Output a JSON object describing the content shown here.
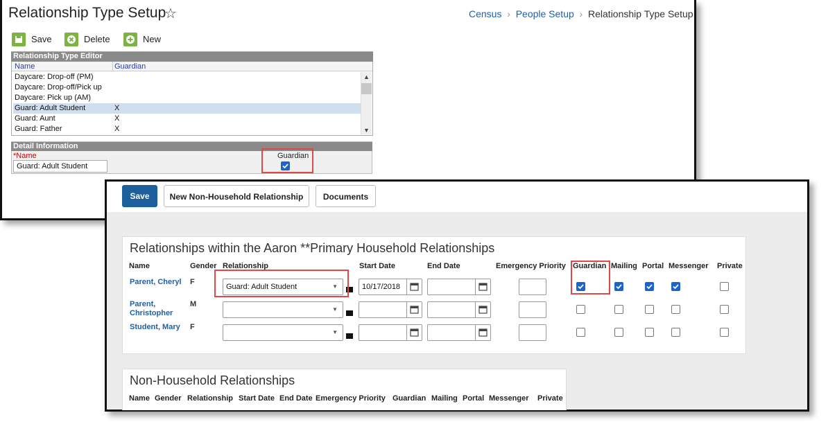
{
  "setup": {
    "title": "Relationship Type Setup",
    "star_icon": "star-icon",
    "breadcrumb": [
      "Census",
      "People Setup",
      "Relationship Type Setup"
    ],
    "toolbar": {
      "save": "Save",
      "delete": "Delete",
      "new": "New"
    },
    "editor": {
      "header": "Relationship Type Editor",
      "col_name": "Name",
      "col_guardian": "Guardian",
      "rows": [
        {
          "name": "Daycare: Drop-off (PM)",
          "guardian": ""
        },
        {
          "name": "Daycare: Drop-off/Pick up",
          "guardian": ""
        },
        {
          "name": "Daycare: Pick up (AM)",
          "guardian": ""
        },
        {
          "name": "Guard: Adult Student",
          "guardian": "X"
        },
        {
          "name": "Guard: Aunt",
          "guardian": "X"
        },
        {
          "name": "Guard: Father",
          "guardian": "X"
        }
      ]
    },
    "detail": {
      "header": "Detail Information",
      "name_label": "*Name",
      "name_value": "Guard: Adult Student",
      "guardian_label": "Guardian"
    }
  },
  "household": {
    "buttons": {
      "save": "Save",
      "new_nonhousehold": "New Non-Household Relationship",
      "documents": "Documents"
    },
    "section_title": "Relationships within the Aaron **Primary Household Relationships",
    "columns": {
      "name": "Name",
      "gender": "Gender",
      "relationship": "Relationship",
      "start_date": "Start Date",
      "end_date": "End Date",
      "priority": "Emergency Priority",
      "guardian": "Guardian",
      "mailing": "Mailing",
      "portal": "Portal",
      "messenger": "Messenger",
      "private": "Private"
    },
    "rows": [
      {
        "name": "Parent, Cheryl",
        "gender": "F",
        "relationship": "Guard: Adult Student",
        "start_date": "10/17/2018"
      },
      {
        "name": "Parent, Christopher",
        "gender": "M",
        "relationship": "",
        "start_date": ""
      },
      {
        "name": "Student, Mary",
        "gender": "F",
        "relationship": "",
        "start_date": ""
      }
    ]
  },
  "nonhousehold": {
    "section_title": "Non-Household Relationships",
    "columns": {
      "name": "Name",
      "gender": "Gender",
      "relationship": "Relationship",
      "start_date": "Start Date",
      "end_date": "End Date",
      "priority": "Emergency Priority",
      "guardian": "Guardian",
      "mailing": "Mailing",
      "portal": "Portal",
      "messenger": "Messenger",
      "private": "Private"
    }
  }
}
